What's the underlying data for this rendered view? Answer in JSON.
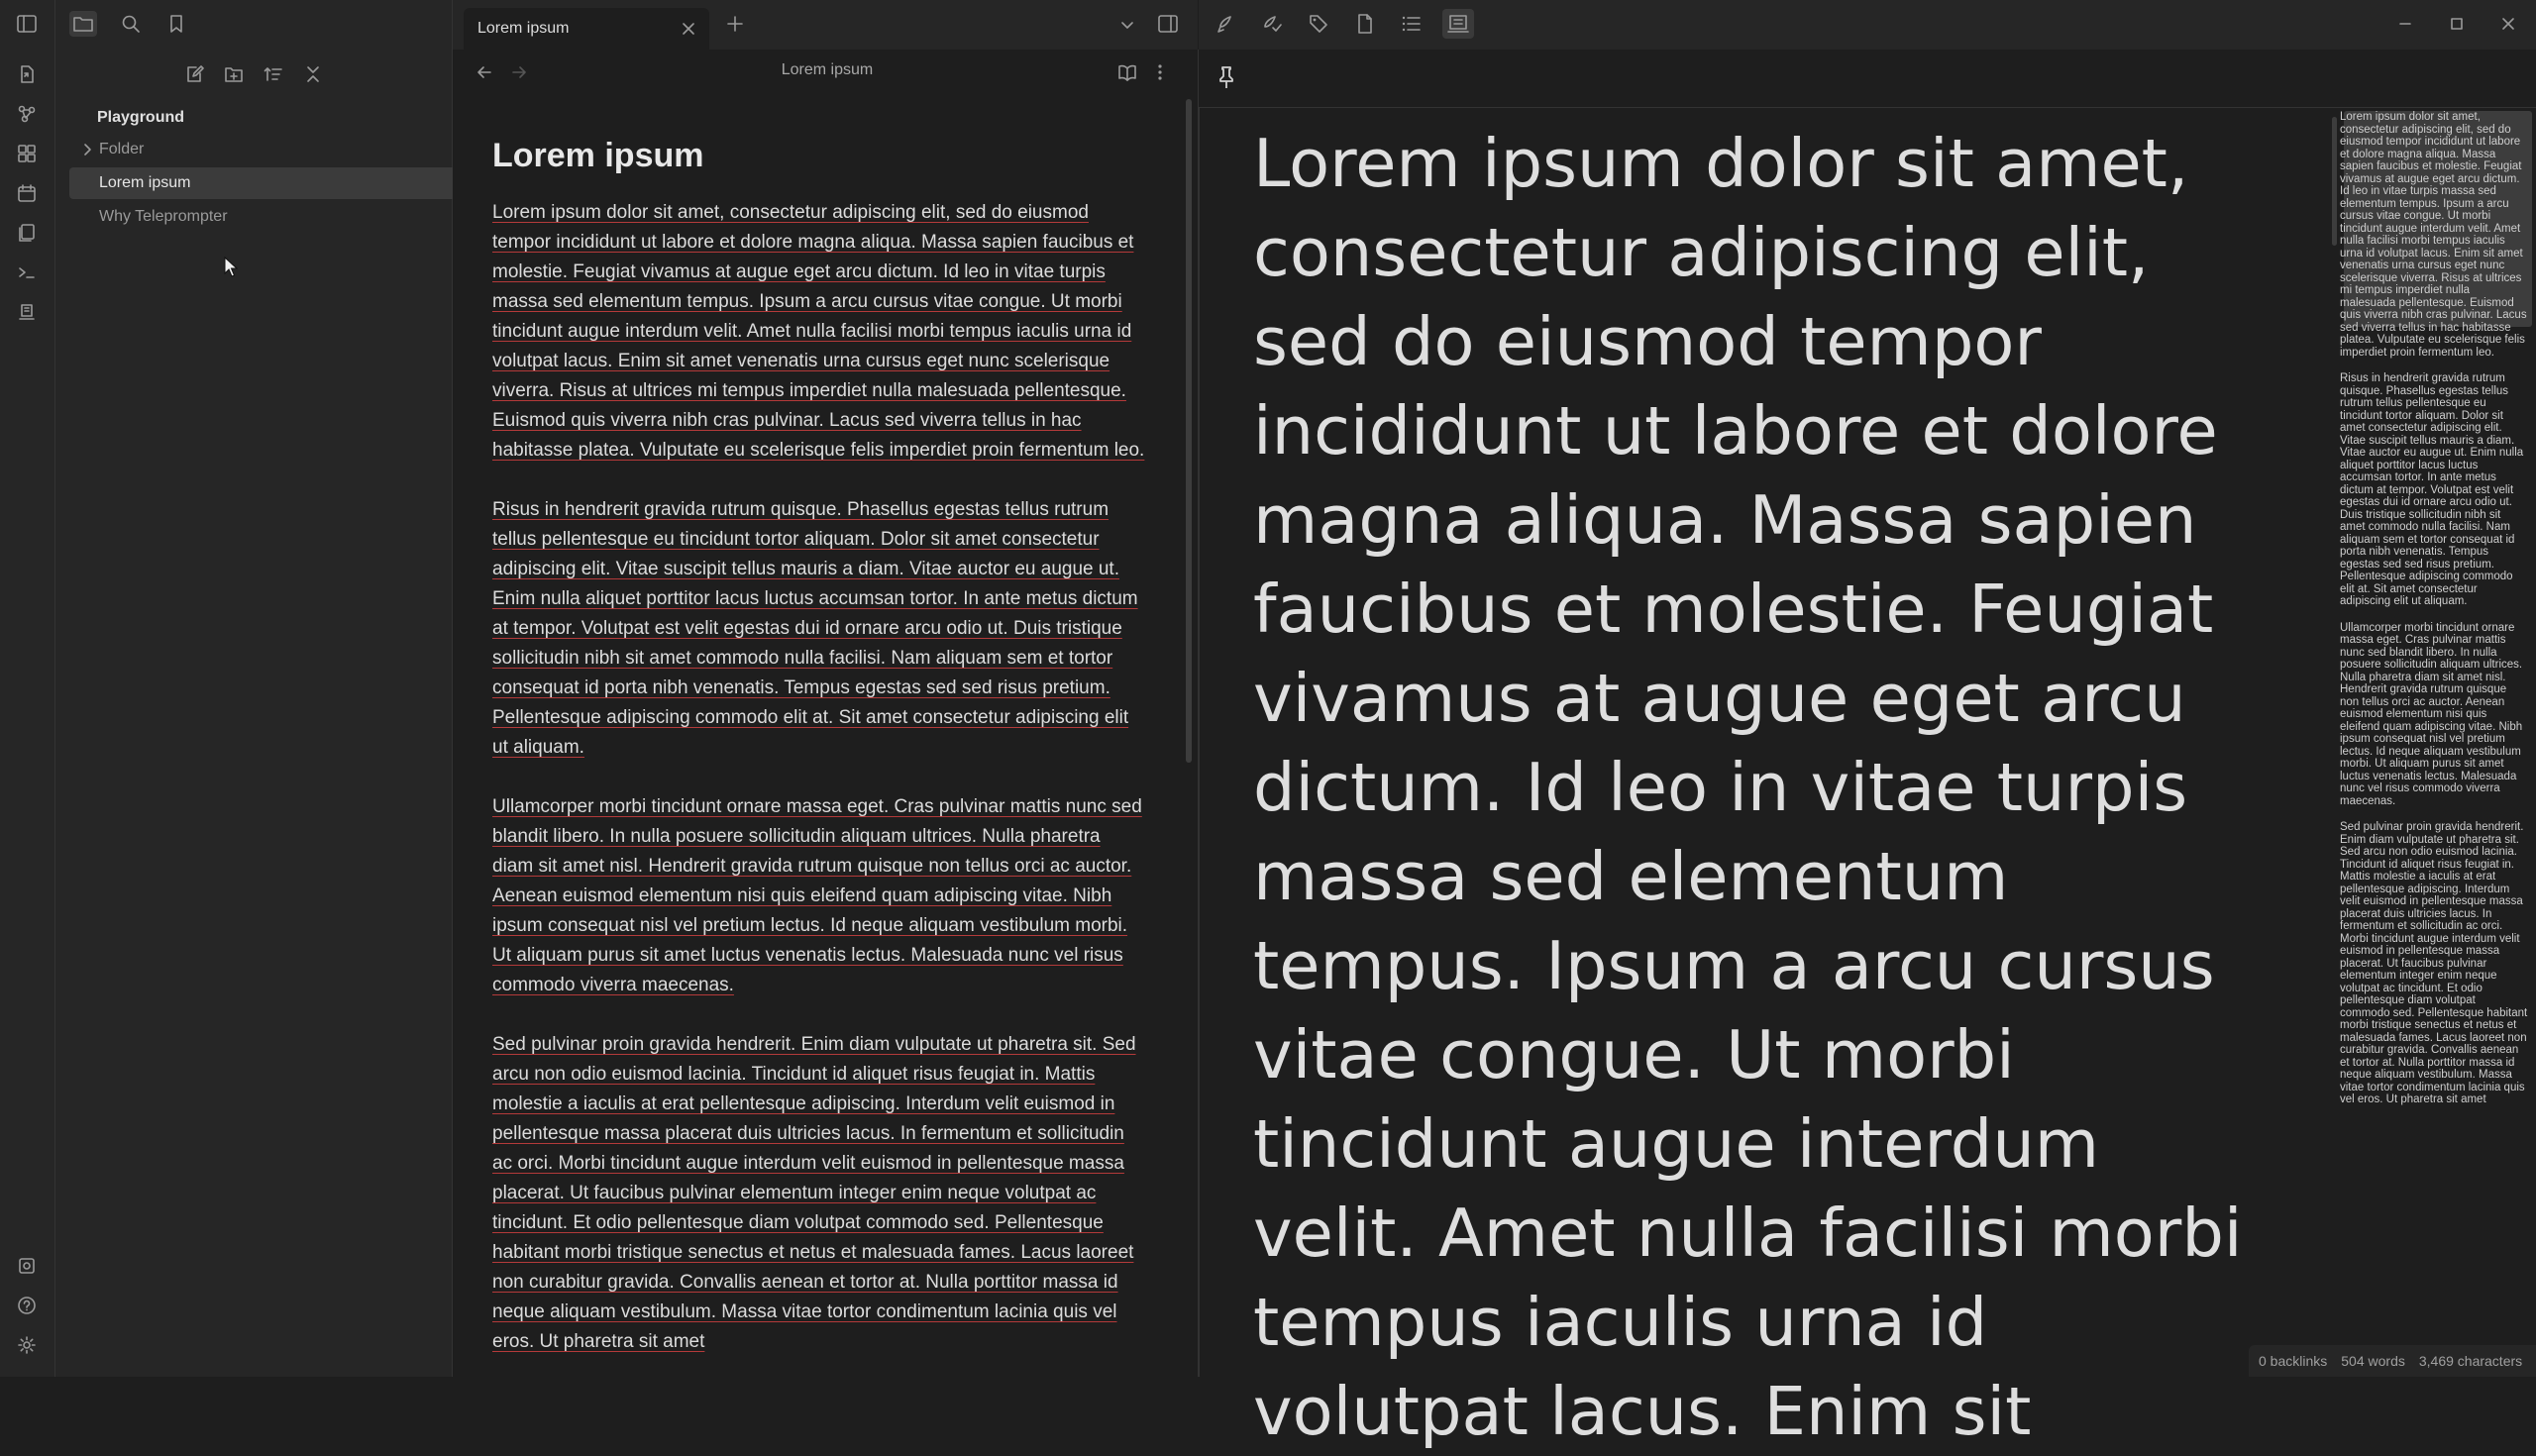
{
  "sidebar": {
    "vault_name": "Playground",
    "items": [
      {
        "label": "Folder"
      },
      {
        "label": "Lorem ipsum"
      },
      {
        "label": "Why Teleprompter"
      }
    ]
  },
  "tabs": [
    {
      "label": "Lorem ipsum"
    }
  ],
  "view_header": {
    "title": "Lorem ipsum"
  },
  "document": {
    "title": "Lorem ipsum",
    "paragraphs": [
      "Lorem ipsum dolor sit amet, consectetur adipiscing elit, sed do eiusmod tempor incididunt ut labore et dolore magna aliqua. Massa sapien faucibus et molestie. Feugiat vivamus at augue eget arcu dictum. Id leo in vitae turpis massa sed elementum tempus. Ipsum a arcu cursus vitae congue. Ut morbi tincidunt augue interdum velit. Amet nulla facilisi morbi tempus iaculis urna id volutpat lacus. Enim sit amet venenatis urna cursus eget nunc scelerisque viverra. Risus at ultrices mi tempus imperdiet nulla malesuada pellentesque. Euismod quis viverra nibh cras pulvinar. Lacus sed viverra tellus in hac habitasse platea. Vulputate eu scelerisque felis imperdiet proin fermentum leo.",
      "Risus in hendrerit gravida rutrum quisque. Phasellus egestas tellus rutrum tellus pellentesque eu tincidunt tortor aliquam. Dolor sit amet consectetur adipiscing elit. Vitae suscipit tellus mauris a diam. Vitae auctor eu augue ut. Enim nulla aliquet porttitor lacus luctus accumsan tortor. In ante metus dictum at tempor. Volutpat est velit egestas dui id ornare arcu odio ut. Duis tristique sollicitudin nibh sit amet commodo nulla facilisi. Nam aliquam sem et tortor consequat id porta nibh venenatis. Tempus egestas sed sed risus pretium. Pellentesque adipiscing commodo elit at. Sit amet consectetur adipiscing elit ut aliquam.",
      "Ullamcorper morbi tincidunt ornare massa eget. Cras pulvinar mattis nunc sed blandit libero. In nulla posuere sollicitudin aliquam ultrices. Nulla pharetra diam sit amet nisl. Hendrerit gravida rutrum quisque non tellus orci ac auctor. Aenean euismod elementum nisi quis eleifend quam adipiscing vitae. Nibh ipsum consequat nisl vel pretium lectus. Id neque aliquam vestibulum morbi. Ut aliquam purus sit amet luctus venenatis lectus. Malesuada nunc vel risus commodo viverra maecenas.",
      "Sed pulvinar proin gravida hendrerit. Enim diam vulputate ut pharetra sit. Sed arcu non odio euismod lacinia. Tincidunt id aliquet risus feugiat in. Mattis molestie a iaculis at erat pellentesque adipiscing. Interdum velit euismod in pellentesque massa placerat duis ultricies lacus. In fermentum et sollicitudin ac orci. Morbi tincidunt augue interdum velit euismod in pellentesque massa placerat. Ut faucibus pulvinar elementum integer enim neque volutpat ac tincidunt. Et odio pellentesque diam volutpat commodo sed. Pellentesque habitant morbi tristique senectus et netus et malesuada fames. Lacus laoreet non curabitur gravida. Convallis aenean et tortor at. Nulla porttitor massa id neque aliquam vestibulum. Massa vitae tortor condimentum lacinia quis vel eros. Ut pharetra sit amet"
    ]
  },
  "teleprompter": {
    "text": "Lorem ipsum dolor sit amet, consectetur adipiscing elit, sed do eiusmod tempor incididunt ut labore et dolore magna aliqua. Massa sapien faucibus et molestie. Feugiat vivamus at augue eget arcu dictum. Id leo in vitae turpis massa sed elementum tempus. Ipsum a arcu cursus vitae congue. Ut morbi tincidunt augue interdum velit. Amet nulla facilisi morbi tempus iaculis urna id volutpat lacus. Enim sit"
  },
  "status": {
    "backlinks": "0 backlinks",
    "words": "504 words",
    "characters": "3,469 characters"
  },
  "colors": {
    "background": "#1e1e1e",
    "panel": "#262626",
    "spellcheck_underline": "#b43a3a"
  }
}
